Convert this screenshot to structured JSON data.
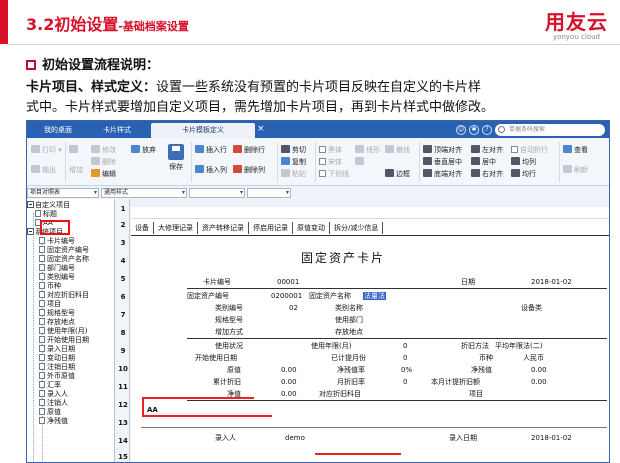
{
  "slide": {
    "title": "3.2初始设置",
    "subtitle": "-基础档案设置",
    "logo_text": "用友云",
    "logo_sub": "yonyou cloud",
    "section_heading": "初始设置流程说明：",
    "para_bold": "卡片项目、样式定义：",
    "para_line1": "设置一些系统没有预置的卡片项目反映在自定义的卡片样",
    "para_line2": "式中。卡片样式要增加自定义项目，需先增加卡片项目，再到卡片样式中做修改。"
  },
  "window": {
    "tabs": [
      "我的桌面",
      "卡片样式",
      "卡片模板定义"
    ],
    "search_placeholder": "单据条码搜索",
    "colors": {
      "titlebar": "#2a62b3",
      "accent_red": "#d8102a"
    }
  },
  "toolbar": {
    "print": "打印",
    "output": "输出",
    "add": "增加",
    "modify": "修改",
    "delete": "删除",
    "edit": "编辑",
    "abandon": "放弃",
    "save": "保存",
    "insert_row": "插入行",
    "delete_row": "删除行",
    "insert_col": "插入列",
    "delete_col": "删除列",
    "cut": "剪切",
    "copy": "复制",
    "paste": "粘贴",
    "font_body": "黑体",
    "font_song": "宋体",
    "underline": "下划线",
    "line_shape": "线形",
    "border_line": "撤线",
    "fill_color": "颜色",
    "border": "边框",
    "align_top": "顶端对齐",
    "align_vcenter": "垂直居中",
    "align_bottom": "底端对齐",
    "align_left": "左对齐",
    "align_hcenter": "居中",
    "align_right": "右对齐",
    "auto_wrap": "自动折行",
    "equal_col": "均列",
    "equal_row": "均行",
    "view": "查看",
    "refresh": "刷新"
  },
  "formatbar": {
    "range_label": "项目对照表",
    "style_label": "通用样式"
  },
  "tree": {
    "items": [
      "自定义项目",
      "标题",
      "AA",
      "系统项目",
      "卡片编号",
      "固定资产编号",
      "固定资产名称",
      "部门编号",
      "类别编号",
      "币种",
      "对应折旧科目",
      "项目",
      "规格型号",
      "存放地点",
      "使用年限(月)",
      "开始使用日期",
      "录入日期",
      "变动日期",
      "注销日期",
      "外币原值",
      "汇率",
      "录入人",
      "注销人",
      "原值",
      "净残值"
    ]
  },
  "rows": [
    "1",
    "2",
    "3",
    "4",
    "5",
    "6",
    "7",
    "8",
    "9",
    "10",
    "11",
    "12",
    "13",
    "14",
    "15"
  ],
  "card": {
    "tabs": [
      "设备",
      "大修理记录",
      "资产转移记录",
      "停启用记录",
      "原值变动",
      "拆分/减少信息"
    ],
    "title": "固定资产卡片",
    "card_no_label": "卡片编号",
    "card_no": "00001",
    "date_label": "日期",
    "date": "2018-01-02",
    "asset_no_label": "固定资产编号",
    "asset_no": "0200001",
    "asset_name_label": "固定资产名称",
    "asset_name": "法量法",
    "class_no_label": "类别编号",
    "class_no": "02",
    "class_name_label": "类别名称",
    "class_name": "设备类",
    "spec_label": "规格型号",
    "dept_label": "使用部门",
    "add_method_label": "增加方式",
    "location_label": "存放地点",
    "status_label": "使用状况",
    "life_label": "使用年限(月)",
    "life": "0",
    "method_label": "折旧方法",
    "method": "平均年限法(二)",
    "start_label": "开始使用日期",
    "accrued_label": "已计提月份",
    "accrued": "0",
    "currency_label": "币种",
    "currency": "人民币",
    "orig_label": "原值",
    "orig": "0.00",
    "salvage_rate_label": "净残值率",
    "salvage_rate": "0%",
    "salvage_label": "净残值",
    "salvage": "0.00",
    "acc_dep_label": "累计折旧",
    "acc_dep": "0.00",
    "mon_rate_label": "月折旧率",
    "mon_rate": "0",
    "mon_dep_label": "本月计提折旧额",
    "mon_dep": "0.00",
    "net_label": "净值",
    "net": "0.00",
    "acct_label": "对应折旧科目",
    "item_label": "项目",
    "custom_label": "AA",
    "entry_user_label": "录入人",
    "entry_user": "demo",
    "entry_date_label": "录入日期",
    "entry_date": "2018-01-02"
  }
}
